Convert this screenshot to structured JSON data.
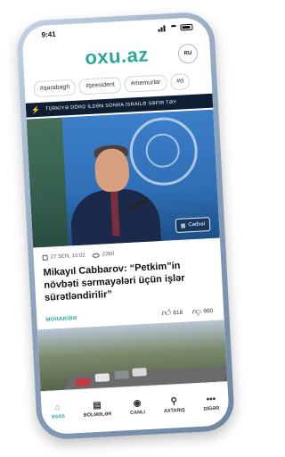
{
  "status_bar": {
    "time": "9:41"
  },
  "header": {
    "logo": "oxu.az",
    "lang": "RU"
  },
  "tags": [
    "#qarabagh",
    "#president",
    "#memurlar",
    "#d"
  ],
  "ticker": {
    "text": "TÜRKİYƏ DÖRD İLDƏN SONRA İSRAİLƏ SƏFİR TƏY"
  },
  "article": {
    "badge": "Cədvəl",
    "date": "27 SEN, 10:02",
    "views": "2260",
    "title": "Mikayıl Cabbarov: “Petkim”in növbəti sərmayələri üçün işlər sürətləndirilir”",
    "category": "MÜHARİBƏ",
    "likes": "818",
    "dislikes": "900"
  },
  "tabbar": {
    "items": [
      {
        "label": "ƏSAS",
        "icon": "home-icon"
      },
      {
        "label": "BÖLMƏLƏR",
        "icon": "sections-icon"
      },
      {
        "label": "CANLI",
        "icon": "tv-icon"
      },
      {
        "label": "AXTARIŞ",
        "icon": "search-icon"
      },
      {
        "label": "DİGƏR",
        "icon": "more-icon"
      }
    ]
  },
  "colors": {
    "accent": "#2aa79c",
    "ticker_bg": "#0e1f33"
  }
}
